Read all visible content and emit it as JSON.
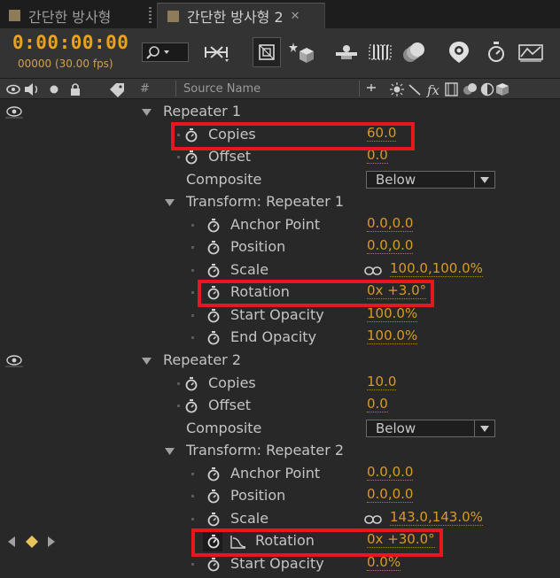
{
  "tabs": [
    {
      "label": "간단한 방사형",
      "active": false
    },
    {
      "label": "간단한 방사형 2",
      "active": true
    }
  ],
  "toolbar": {
    "timecode": "0:00:00:00",
    "frames": "00000 (30.00 fps)",
    "icons": [
      "search-icon",
      "flowchart-icon",
      "draft-3d-icon",
      "shy-layers-icon",
      "frame-blending-icon",
      "motion-blur-icon",
      "brainstorm-icon",
      "graph-editor-icon",
      "stopwatch-icon",
      "live-update-icon"
    ]
  },
  "columns": {
    "hash": "#",
    "source_name": "Source Name",
    "switch_symbols": "fx"
  },
  "rows": [
    {
      "label": "Repeater 1",
      "type": "group"
    },
    {
      "label": "Copies",
      "value": "60.0",
      "highlight": true
    },
    {
      "label": "Offset",
      "value": "0.0"
    },
    {
      "label": "Composite",
      "dropdown": "Below"
    },
    {
      "label": "Transform: Repeater 1",
      "type": "subgroup"
    },
    {
      "label": "Anchor Point",
      "value": "0.0,0.0"
    },
    {
      "label": "Position",
      "value": "0.0,0.0"
    },
    {
      "label": "Scale",
      "value": "100.0,100.0",
      "unit": "%"
    },
    {
      "label": "Rotation",
      "value": "0x +3.0°",
      "highlight": true
    },
    {
      "label": "Start Opacity",
      "value": "100.0",
      "unit": "%"
    },
    {
      "label": "End Opacity",
      "value": "100.0",
      "unit": "%"
    },
    {
      "label": "Repeater 2",
      "type": "group"
    },
    {
      "label": "Copies",
      "value": "10.0"
    },
    {
      "label": "Offset",
      "value": "0.0"
    },
    {
      "label": "Composite",
      "dropdown": "Below"
    },
    {
      "label": "Transform: Repeater 2",
      "type": "subgroup"
    },
    {
      "label": "Anchor Point",
      "value": "0.0,0.0"
    },
    {
      "label": "Position",
      "value": "0.0,0.0"
    },
    {
      "label": "Scale",
      "value": "143.0,143.0",
      "unit": "%"
    },
    {
      "label": "Rotation",
      "value": "0x +30.0°",
      "highlight": true,
      "keyframed": true
    },
    {
      "label": "Start Opacity",
      "value": "0.0",
      "unit": "%"
    }
  ],
  "colors": {
    "accent_value": "#d99a26",
    "timecode": "#e8a21d",
    "highlight_box": "#e8161e",
    "background": "#282828"
  }
}
